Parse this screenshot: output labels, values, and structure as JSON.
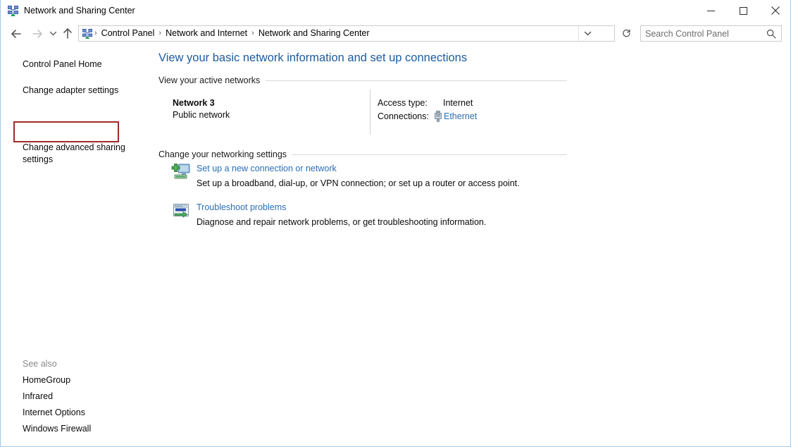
{
  "window": {
    "title": "Network and Sharing Center",
    "title_icon": "network-sharing-icon",
    "controls": {
      "minimize": "minimize-button",
      "maximize": "maximize-button",
      "close": "close-button"
    }
  },
  "navbar": {
    "back": "back-arrow-icon",
    "forward": "forward-arrow-icon",
    "history": "recent-locations-chevron-icon",
    "up": "up-arrow-icon",
    "address_icon": "network-sharing-icon",
    "breadcrumbs": [
      "Control Panel",
      "Network and Internet",
      "Network and Sharing Center"
    ],
    "separator": "›",
    "dropdown": "chevron-down-icon",
    "refresh": "refresh-icon"
  },
  "search": {
    "placeholder": "Search Control Panel",
    "value": "",
    "icon": "search-icon"
  },
  "sidebar": {
    "links": [
      {
        "label": "Control Panel Home",
        "highlighted": false
      },
      {
        "label": "Change adapter settings",
        "highlighted": true
      },
      {
        "label": "Change advanced sharing settings",
        "highlighted": false
      }
    ],
    "highlight_color": "#a32929",
    "see_also_label": "See also",
    "see_also": [
      "HomeGroup",
      "Infrared",
      "Internet Options",
      "Windows Firewall"
    ]
  },
  "main": {
    "heading": "View your basic network information and set up connections",
    "heading_color": "#1e5b9e",
    "link_color": "#2a6fb5",
    "sections": [
      {
        "title": "View your active networks"
      },
      {
        "title": "Change your networking settings"
      }
    ],
    "active_network": {
      "name": "Network  3",
      "type": "Public network",
      "access_type_label": "Access type:",
      "access_type_value": "Internet",
      "connections_label": "Connections:",
      "connection_icon": "ethernet-plug-icon",
      "connection_name": "Ethernet"
    },
    "tasks": [
      {
        "icon": "new-connection-icon",
        "link": "Set up a new connection or network",
        "description": "Set up a broadband, dial-up, or VPN connection; or set up a router or access point."
      },
      {
        "icon": "troubleshoot-icon",
        "link": "Troubleshoot problems",
        "description": "Diagnose and repair network problems, or get troubleshooting information."
      }
    ]
  }
}
